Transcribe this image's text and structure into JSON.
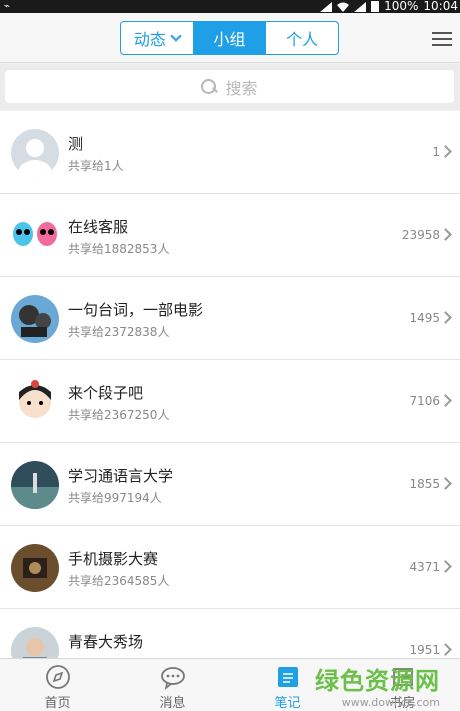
{
  "statusbar": {
    "battery": "100%",
    "time": "10:04"
  },
  "header": {
    "tabs": [
      {
        "label": "动态",
        "active": false,
        "dropdown": true
      },
      {
        "label": "小组",
        "active": true
      },
      {
        "label": "个人",
        "active": false
      }
    ]
  },
  "search": {
    "placeholder": "搜索"
  },
  "groups": [
    {
      "name": "测",
      "shared": "共享给1人",
      "count": "1",
      "avatar": "default-avatar"
    },
    {
      "name": "在线客服",
      "shared": "共享给1882853人",
      "count": "23958",
      "avatar": "alien-twins"
    },
    {
      "name": "一句台词，一部电影",
      "shared": "共享给2372838人",
      "count": "1495",
      "avatar": "film-projector"
    },
    {
      "name": "来个段子吧",
      "shared": "共享给2367250人",
      "count": "7106",
      "avatar": "cartoon-girl"
    },
    {
      "name": "学习通语言大学",
      "shared": "共享给997194人",
      "count": "1855",
      "avatar": "landscape-photo"
    },
    {
      "name": "手机摄影大赛",
      "shared": "共享给2364585人",
      "count": "4371",
      "avatar": "vintage-camera"
    },
    {
      "name": "青春大秀场",
      "shared": "",
      "count": "1951",
      "avatar": "portrait-photo"
    }
  ],
  "tabbar": [
    {
      "label": "首页",
      "icon": "compass-icon",
      "active": false
    },
    {
      "label": "消息",
      "icon": "chat-bubble-icon",
      "active": false
    },
    {
      "label": "笔记",
      "icon": "note-icon",
      "active": true
    },
    {
      "label": "书房",
      "icon": "bookshelf-icon",
      "active": false
    }
  ],
  "watermark": {
    "title": "绿色资源网",
    "url": "www.downcc.com"
  },
  "colors": {
    "accent": "#1e9fe6",
    "watermark_green": "#6cc04a"
  }
}
